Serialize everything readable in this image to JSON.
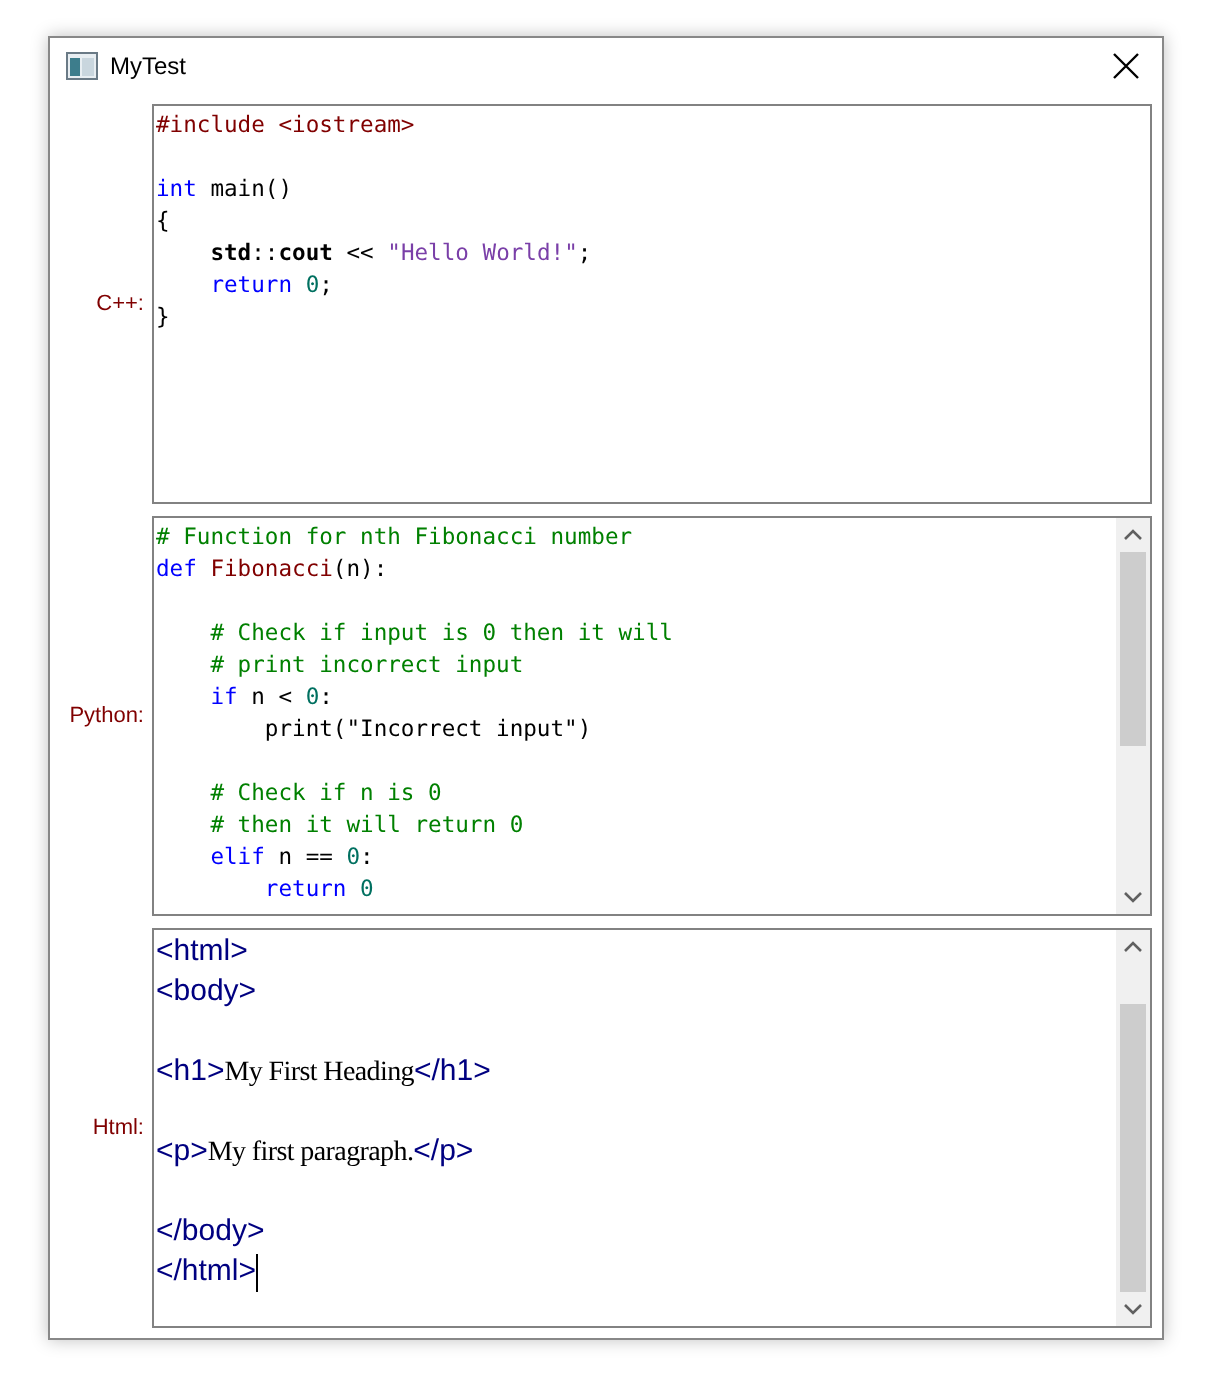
{
  "window": {
    "title": "MyTest"
  },
  "editors": [
    {
      "label": "C++:",
      "kind": "code",
      "scrollbar": false,
      "caret": false,
      "lines": [
        {
          "kind": "code",
          "tokens": [
            {
              "text": "#include <iostream>",
              "kind": "preprocessor"
            }
          ]
        },
        {
          "kind": "blank"
        },
        {
          "kind": "code",
          "tokens": [
            {
              "text": "int",
              "kind": "keyword"
            },
            {
              "text": " main()",
              "kind": "plain"
            }
          ]
        },
        {
          "kind": "code",
          "tokens": [
            {
              "text": "{",
              "kind": "plain"
            }
          ]
        },
        {
          "kind": "code",
          "tokens": [
            {
              "text": "    std",
              "kind": "name"
            },
            {
              "text": "::",
              "kind": "plain"
            },
            {
              "text": "cout",
              "kind": "name"
            },
            {
              "text": " << ",
              "kind": "plain"
            },
            {
              "text": "\"Hello World!\"",
              "kind": "string"
            },
            {
              "text": ";",
              "kind": "plain"
            }
          ]
        },
        {
          "kind": "code",
          "tokens": [
            {
              "text": "    return",
              "kind": "keyword"
            },
            {
              "text": " 0",
              "kind": "number"
            },
            {
              "text": ";",
              "kind": "plain"
            }
          ]
        },
        {
          "kind": "code",
          "tokens": [
            {
              "text": "}",
              "kind": "plain"
            }
          ]
        }
      ]
    },
    {
      "label": "Python:",
      "kind": "code",
      "scrollbar": true,
      "caret": false,
      "lines": [
        {
          "kind": "code",
          "tokens": [
            {
              "text": "# Function for nth Fibonacci number",
              "kind": "comment"
            }
          ]
        },
        {
          "kind": "code",
          "tokens": [
            {
              "text": "def",
              "kind": "keyword"
            },
            {
              "text": " Fibonacci",
              "kind": "function"
            },
            {
              "text": "(n):",
              "kind": "plain"
            }
          ]
        },
        {
          "kind": "blank"
        },
        {
          "kind": "code",
          "tokens": [
            {
              "text": "    # Check if input is 0 then it will",
              "kind": "comment"
            }
          ]
        },
        {
          "kind": "code",
          "tokens": [
            {
              "text": "    # print incorrect input",
              "kind": "comment"
            }
          ]
        },
        {
          "kind": "code",
          "tokens": [
            {
              "text": "    if",
              "kind": "keyword"
            },
            {
              "text": " n < ",
              "kind": "plain"
            },
            {
              "text": "0",
              "kind": "number"
            },
            {
              "text": ":",
              "kind": "plain"
            }
          ]
        },
        {
          "kind": "code",
          "tokens": [
            {
              "text": "        print(\"Incorrect input\")",
              "kind": "plain"
            }
          ]
        },
        {
          "kind": "blank"
        },
        {
          "kind": "code",
          "tokens": [
            {
              "text": "    # Check if n is 0",
              "kind": "comment"
            }
          ]
        },
        {
          "kind": "code",
          "tokens": [
            {
              "text": "    # then it will return 0",
              "kind": "comment"
            }
          ]
        },
        {
          "kind": "code",
          "tokens": [
            {
              "text": "    elif",
              "kind": "keyword"
            },
            {
              "text": " n == ",
              "kind": "plain"
            },
            {
              "text": "0",
              "kind": "number"
            },
            {
              "text": ":",
              "kind": "plain"
            }
          ]
        },
        {
          "kind": "code",
          "tokens": [
            {
              "text": "        return",
              "kind": "keyword"
            },
            {
              "text": " 0",
              "kind": "number"
            }
          ]
        }
      ]
    },
    {
      "label": "Html:",
      "kind": "markup",
      "scrollbar": true,
      "caret": true,
      "lines": [
        {
          "kind": "code",
          "tokens": [
            {
              "text": "<html>",
              "kind": "tag"
            }
          ]
        },
        {
          "kind": "code",
          "tokens": [
            {
              "text": "<body>",
              "kind": "tag"
            }
          ]
        },
        {
          "kind": "blank"
        },
        {
          "kind": "code",
          "tokens": [
            {
              "text": "<h1>",
              "kind": "tag"
            },
            {
              "text": "My First Heading",
              "kind": "text"
            },
            {
              "text": "</h1>",
              "kind": "tag"
            }
          ]
        },
        {
          "kind": "blank"
        },
        {
          "kind": "code",
          "tokens": [
            {
              "text": "<p>",
              "kind": "tag"
            },
            {
              "text": "My first paragraph.",
              "kind": "text"
            },
            {
              "text": "</p>",
              "kind": "tag"
            }
          ]
        },
        {
          "kind": "blank"
        },
        {
          "kind": "code",
          "tokens": [
            {
              "text": "</body>",
              "kind": "tag"
            }
          ]
        },
        {
          "kind": "code",
          "tokens": [
            {
              "text": "</html>",
              "kind": "tag"
            }
          ]
        }
      ]
    }
  ]
}
